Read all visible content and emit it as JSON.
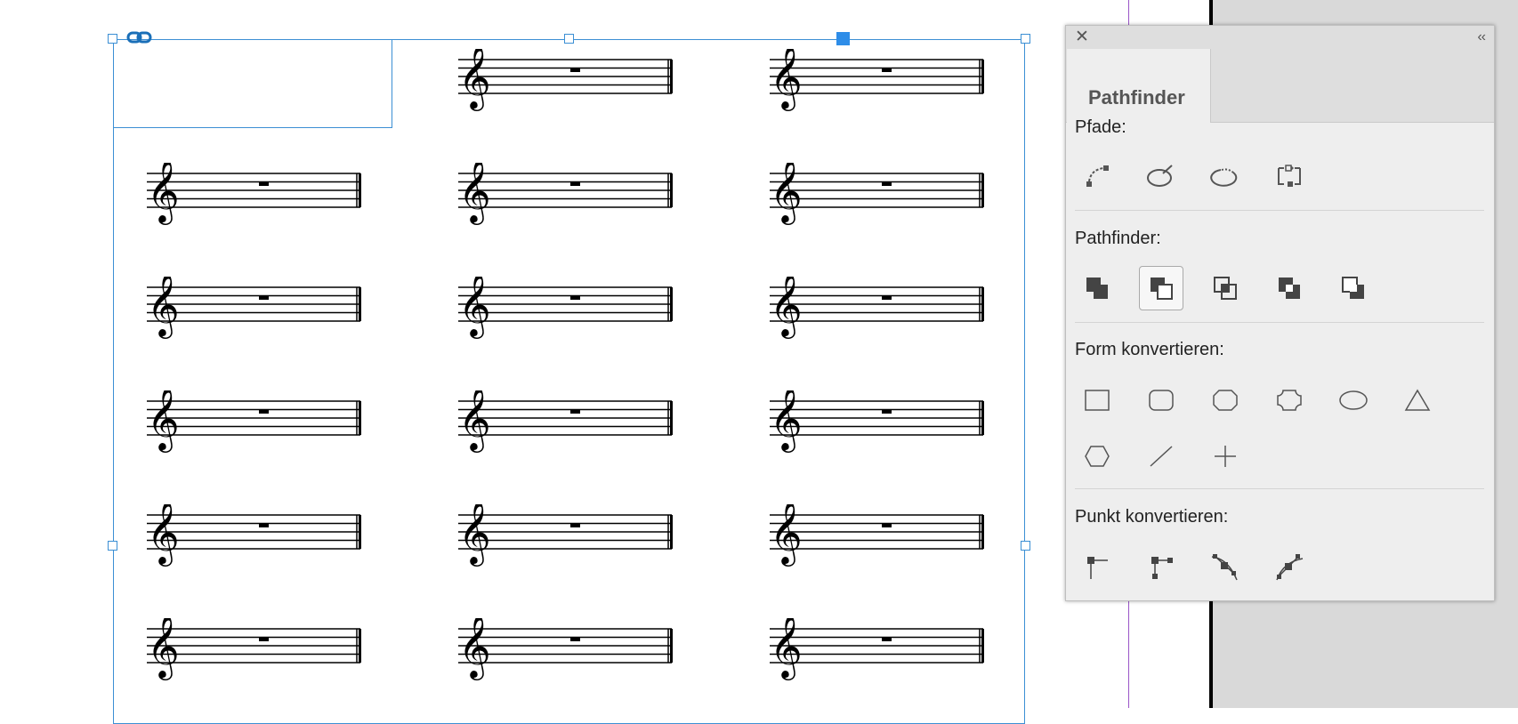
{
  "document": {
    "staff_count": 17
  },
  "panel": {
    "tab_label": "Pathfinder",
    "close_glyph": "✕",
    "collapse_glyph": "‹‹",
    "sections": {
      "paths": {
        "label": "Pfade:",
        "buttons": [
          "join-path-icon",
          "open-path-icon",
          "close-path-icon",
          "reverse-path-icon"
        ]
      },
      "pathfinder": {
        "label": "Pathfinder:",
        "buttons": [
          "add-icon",
          "subtract-icon",
          "intersect-icon",
          "exclude-overlap-icon",
          "minus-back-icon"
        ],
        "selected": "subtract-icon"
      },
      "convert_shape": {
        "label": "Form konvertieren:",
        "buttons": [
          "rectangle-icon",
          "rounded-rectangle-icon",
          "beveled-rectangle-icon",
          "inverse-rounded-rectangle-icon",
          "ellipse-icon",
          "triangle-icon",
          "polygon-icon",
          "line-icon",
          "orthogonal-line-icon"
        ]
      },
      "convert_point": {
        "label": "Punkt konvertieren:",
        "buttons": [
          "plain-point-icon",
          "corner-point-icon",
          "smooth-point-icon",
          "symmetrical-point-icon"
        ]
      }
    }
  },
  "colors": {
    "selection": "#3b8fd4",
    "handle_active": "#2e8de8",
    "guide": "#9a55c8",
    "panel_bg": "#eeeeee",
    "pasteboard": "#d9d9d9"
  }
}
